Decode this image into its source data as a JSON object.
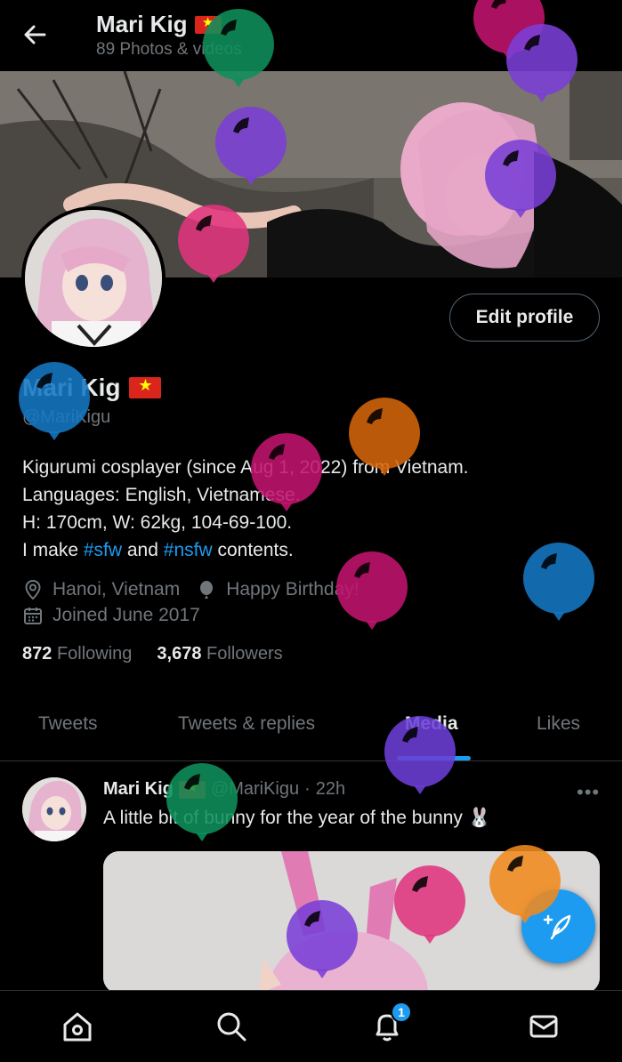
{
  "header": {
    "title": "Mari Kig",
    "subtitle": "89 Photos & videos"
  },
  "profile": {
    "edit_label": "Edit profile",
    "name": "Mari Kig",
    "handle": "@MariKigu",
    "bio_lines": [
      "Kigurumi cosplayer (since Aug 1, 2022) from Vietnam.",
      "Languages: English, Vietnamese.",
      "H: 170cm, W: 62kg, 104-69-100."
    ],
    "bio_last": {
      "pre": "I make ",
      "tag1": "#sfw",
      "mid": " and ",
      "tag2": "#nsfw",
      "post": " contents."
    },
    "location": "Hanoi, Vietnam",
    "birthday": "Happy Birthday!",
    "joined": "Joined June 2017",
    "following_count": "872",
    "following_label": "Following",
    "followers_count": "3,678",
    "followers_label": "Followers"
  },
  "tabs": [
    "Tweets",
    "Tweets & replies",
    "Media",
    "Likes"
  ],
  "active_tab": "Media",
  "tweet": {
    "name": "Mari Kig",
    "handle": "@MariKigu",
    "dot": "·",
    "time": "22h",
    "text": "A little bit of bunny for the year of the bunny 🐰",
    "more": "•••"
  },
  "nav": {
    "notification_badge": "1",
    "icons": [
      "home-icon",
      "search-icon",
      "bell-icon",
      "mail-icon"
    ]
  },
  "colors": {
    "accent": "#1d9bf0",
    "muted": "#71767b",
    "flag_red": "#da251d",
    "flag_star": "#ffff00"
  },
  "balloons": [
    {
      "color": "#0f8f5a"
    },
    {
      "color": "#c2136e"
    },
    {
      "color": "#7a3fd6"
    },
    {
      "color": "#7a3fd6"
    },
    {
      "color": "#7a3fd6"
    },
    {
      "color": "#e0347d"
    },
    {
      "color": "#1577c4"
    },
    {
      "color": "#d4650a"
    },
    {
      "color": "#c2136e"
    },
    {
      "color": "#c2136e"
    },
    {
      "color": "#1577c4"
    },
    {
      "color": "#6b3fd6"
    },
    {
      "color": "#0f8f5a"
    },
    {
      "color": "#e0347d"
    },
    {
      "color": "#7a3fd6"
    },
    {
      "color": "#f08a1c"
    }
  ]
}
